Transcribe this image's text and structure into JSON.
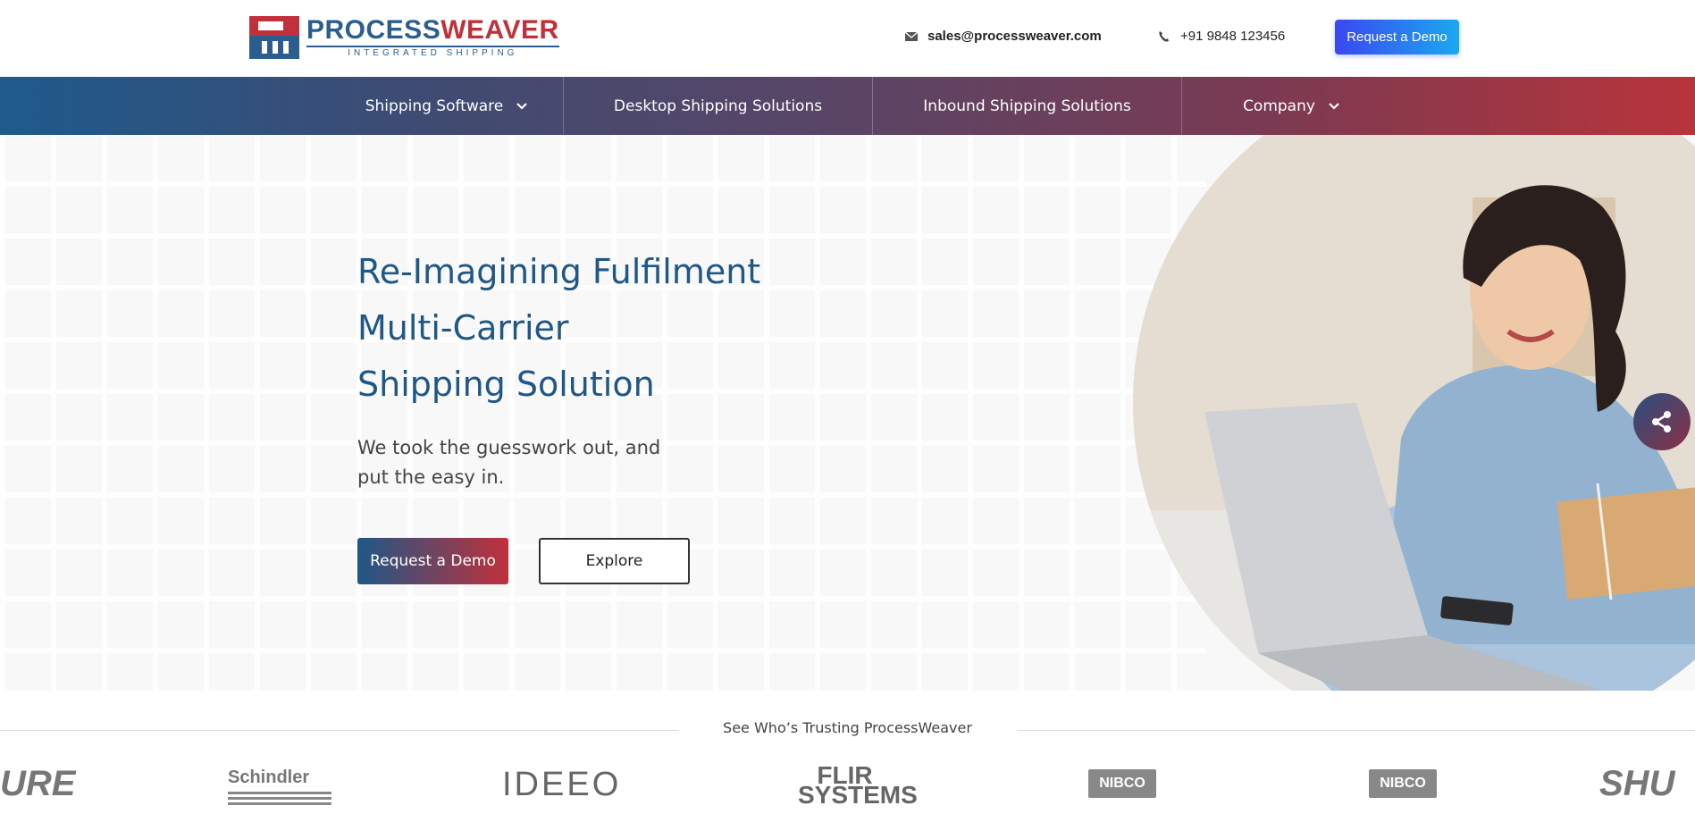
{
  "brand": {
    "name_part1": "PROCESS",
    "name_part2": "WEAVER",
    "tagline": "INTEGRATED SHIPPING",
    "primary_color": "#1f5786",
    "accent_color": "#c0313b"
  },
  "header": {
    "email": "sales@processweaver.com",
    "phone": "+91 9848 123456",
    "demo_button": "Request a Demo",
    "email_icon": "envelope-icon",
    "phone_icon": "phone-icon"
  },
  "nav": {
    "items": [
      {
        "label": "Shipping Software",
        "has_dropdown": true
      },
      {
        "label": "Desktop Shipping Solutions",
        "has_dropdown": false
      },
      {
        "label": "Inbound Shipping Solutions",
        "has_dropdown": false
      },
      {
        "label": "Company",
        "has_dropdown": true
      }
    ]
  },
  "hero": {
    "title_line1": "Re-Imagining Fulfilment",
    "title_line2": "Multi-Carrier",
    "title_line3": "Shipping Solution",
    "subtitle_line1": "We took the guesswork out, and",
    "subtitle_line2": "put the easy in.",
    "primary_cta": "Request a Demo",
    "secondary_cta": "Explore",
    "share_icon": "share-icon"
  },
  "trust": {
    "title": "See Who’s Trusting ProcessWeaver",
    "logos": [
      "URE",
      "Schindler",
      "IDEEO",
      "FLIR SYSTEMS",
      "NIBCO",
      "NIBCO",
      "SHU"
    ]
  }
}
